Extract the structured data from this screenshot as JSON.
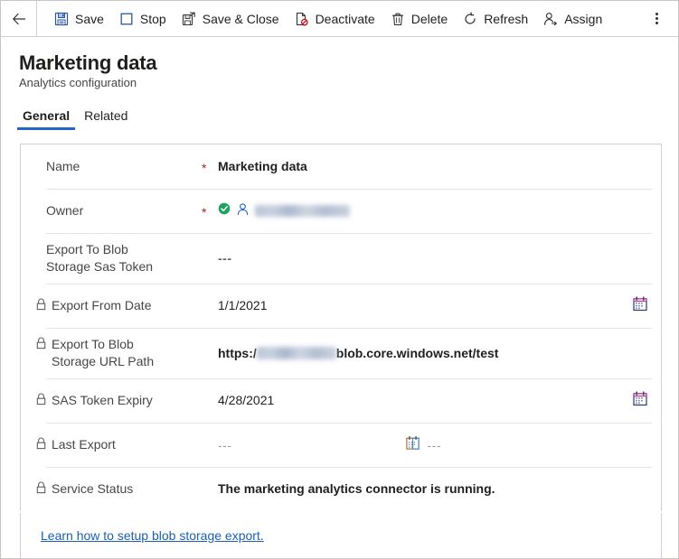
{
  "commandbar": {
    "back_label": "Back",
    "items": [
      {
        "id": "save",
        "label": "Save",
        "icon": "save-icon"
      },
      {
        "id": "stop",
        "label": "Stop",
        "icon": "stop-icon"
      },
      {
        "id": "save-close",
        "label": "Save & Close",
        "icon": "save-and-close-icon"
      },
      {
        "id": "deactivate",
        "label": "Deactivate",
        "icon": "deactivate-icon"
      },
      {
        "id": "delete",
        "label": "Delete",
        "icon": "delete-icon"
      },
      {
        "id": "refresh",
        "label": "Refresh",
        "icon": "refresh-icon"
      },
      {
        "id": "assign",
        "label": "Assign",
        "icon": "assign-icon"
      }
    ],
    "overflow_label": "More commands"
  },
  "header": {
    "title": "Marketing data",
    "subtitle": "Analytics configuration"
  },
  "tabs": [
    {
      "label": "General",
      "active": true
    },
    {
      "label": "Related",
      "active": false
    }
  ],
  "form": {
    "rows": [
      {
        "id": "name",
        "label": "Name",
        "required": "*",
        "locked": false,
        "value": "Marketing data"
      },
      {
        "id": "owner",
        "label": "Owner",
        "required": "*",
        "locked": false,
        "value": "",
        "redacted": true
      },
      {
        "id": "export-to-blob-storage-sas-token",
        "label": "Export To Blob Storage Sas Token",
        "required": "",
        "locked": false,
        "value": "---"
      },
      {
        "id": "export-from-date",
        "label": "Export From Date",
        "required": "",
        "locked": true,
        "value": "1/1/2021"
      },
      {
        "id": "export-to-blob-storage-url-path",
        "label": "Export To Blob Storage URL Path",
        "required": "",
        "locked": true,
        "url_prefix": "https:/",
        "url_suffix": "blob.core.windows.net/test"
      },
      {
        "id": "sas-token-expiry",
        "label": "SAS Token Expiry",
        "required": "",
        "locked": true,
        "value": "4/28/2021"
      },
      {
        "id": "last-export",
        "label": "Last Export",
        "required": "",
        "locked": true,
        "value": "---",
        "value2": "---"
      },
      {
        "id": "service-status",
        "label": "Service Status",
        "required": "",
        "locked": true,
        "value": "The marketing analytics connector is running."
      }
    ]
  },
  "footer": {
    "link_text": "Learn how to setup blob storage export."
  },
  "colors": {
    "accent": "#2266cc",
    "link": "#1a5fb4",
    "required": "#a4262c",
    "success": "#1aa260",
    "icon_blue": "#2b579a",
    "border": "#d2d0ce"
  }
}
